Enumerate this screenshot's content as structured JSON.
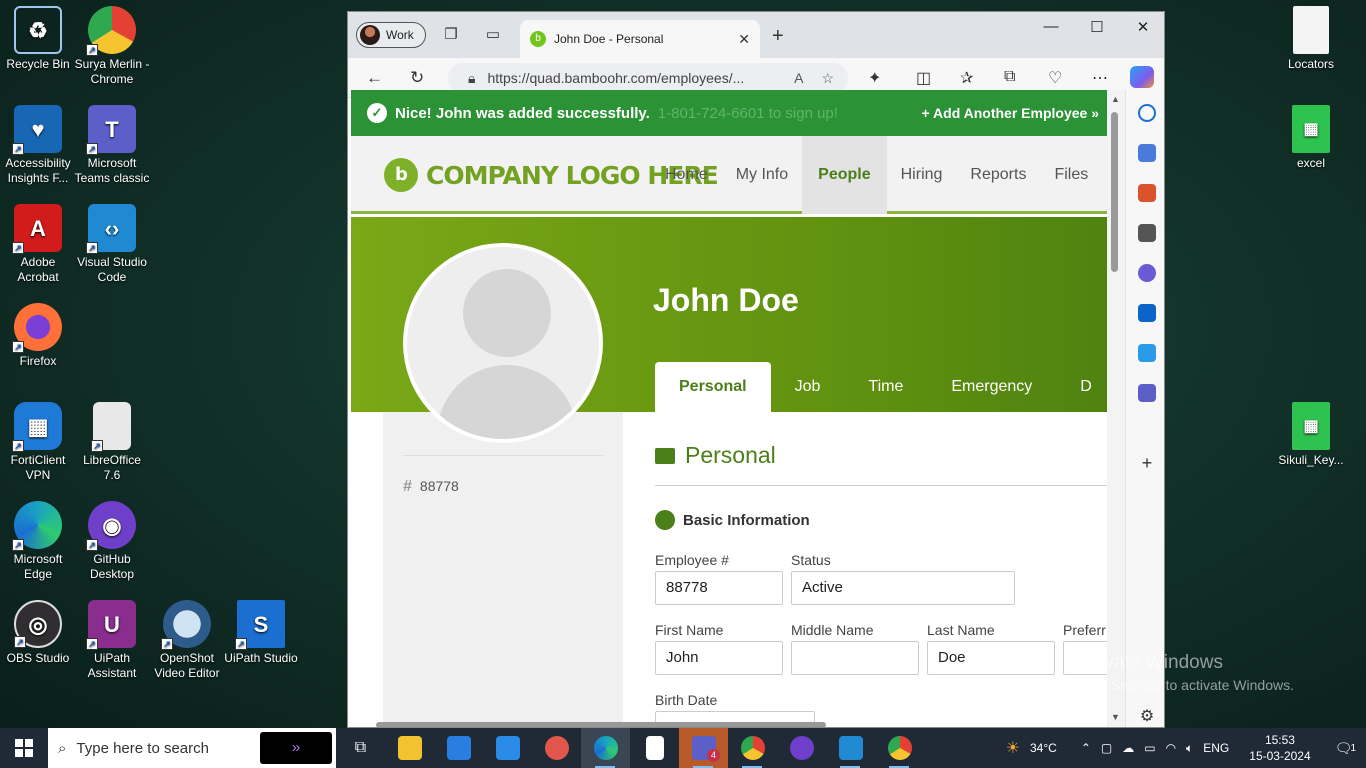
{
  "desktop": {
    "icons_left": [
      {
        "label": "Recycle Bin",
        "icon": "recycle-bin-icon",
        "color": "#5aa7e6"
      },
      {
        "label": "Surya Merlin - Chrome",
        "icon": "chrome-icon",
        "color": "#e44134"
      },
      {
        "label": "Accessibility Insights F...",
        "icon": "accessibility-insights-icon",
        "color": "#1767b4"
      },
      {
        "label": "Microsoft Teams classic",
        "icon": "teams-icon",
        "color": "#5b5fc7"
      },
      {
        "label": "Adobe Acrobat",
        "icon": "acrobat-icon",
        "color": "#d21b1b"
      },
      {
        "label": "Visual Studio Code",
        "icon": "vscode-icon",
        "color": "#1f8ad2"
      },
      {
        "label": "Firefox",
        "icon": "firefox-icon",
        "color": "#ff7139"
      },
      {
        "label": "FortiClient VPN",
        "icon": "forticlient-icon",
        "color": "#1e7ad6"
      },
      {
        "label": "LibreOffice 7.6",
        "icon": "libreoffice-icon",
        "color": "#e8e8e8"
      },
      {
        "label": "Microsoft Edge",
        "icon": "edge-icon",
        "color": "#1aa3c2"
      },
      {
        "label": "GitHub Desktop",
        "icon": "github-desktop-icon",
        "color": "#6e40c9"
      },
      {
        "label": "OBS Studio",
        "icon": "obs-icon",
        "color": "#302e31"
      },
      {
        "label": "UiPath Assistant",
        "icon": "uipath-assistant-icon",
        "color": "#8a2d8f"
      },
      {
        "label": "OpenShot Video Editor",
        "icon": "openshot-icon",
        "color": "#2d5b8a"
      },
      {
        "label": "UiPath Studio",
        "icon": "uipath-studio-icon",
        "color": "#1a6fd1"
      }
    ],
    "icons_right": [
      {
        "label": "Locators",
        "icon": "text-file-icon"
      },
      {
        "label": "excel",
        "icon": "excel-file-icon"
      },
      {
        "label": "Sikuli_Key...",
        "icon": "excel-file-icon"
      }
    ],
    "watermark": {
      "title": "Activate Windows",
      "subtitle": "Go to Settings to activate Windows."
    }
  },
  "browser": {
    "profile": "Work",
    "tab_title": "John Doe - Personal",
    "url": "https://quad.bamboohr.com/employees/...",
    "window_controls": [
      "minimize",
      "maximize",
      "close"
    ]
  },
  "page": {
    "banner": {
      "message": "Nice! John was added successfully.",
      "ghost_text": "1-801-724-6601 to sign up!",
      "action": "+ Add Another Employee »"
    },
    "logo_text": "COMPANY LOGO HERE",
    "nav": [
      "Home",
      "My Info",
      "People",
      "Hiring",
      "Reports",
      "Files"
    ],
    "nav_active": "People",
    "employee_name": "John Doe",
    "tabs": [
      "Personal",
      "Job",
      "Time Off",
      "Emergency",
      "D"
    ],
    "tab_active": "Personal",
    "employee_number_display": "88778",
    "section_title": "Personal",
    "subsection_title": "Basic Information",
    "fields": {
      "employee_no": {
        "label": "Employee #",
        "value": "88778"
      },
      "status": {
        "label": "Status",
        "value": "Active"
      },
      "first_name": {
        "label": "First Name",
        "value": "John"
      },
      "middle_name": {
        "label": "Middle Name",
        "value": ""
      },
      "last_name": {
        "label": "Last Name",
        "value": "Doe"
      },
      "preferred_name": {
        "label": "Preferr",
        "value": ""
      },
      "birth_date": {
        "label": "Birth Date",
        "value": ""
      }
    }
  },
  "taskbar": {
    "search_placeholder": "Type here to search",
    "weather": "34°C",
    "language": "ENG",
    "time": "15:53",
    "date": "15-03-2024",
    "notification_count": "1",
    "teams_badge": "4"
  },
  "colors": {
    "brand_green": "#73a222",
    "banner_green": "#2c9236",
    "nav_active": "#4b7f1a"
  }
}
